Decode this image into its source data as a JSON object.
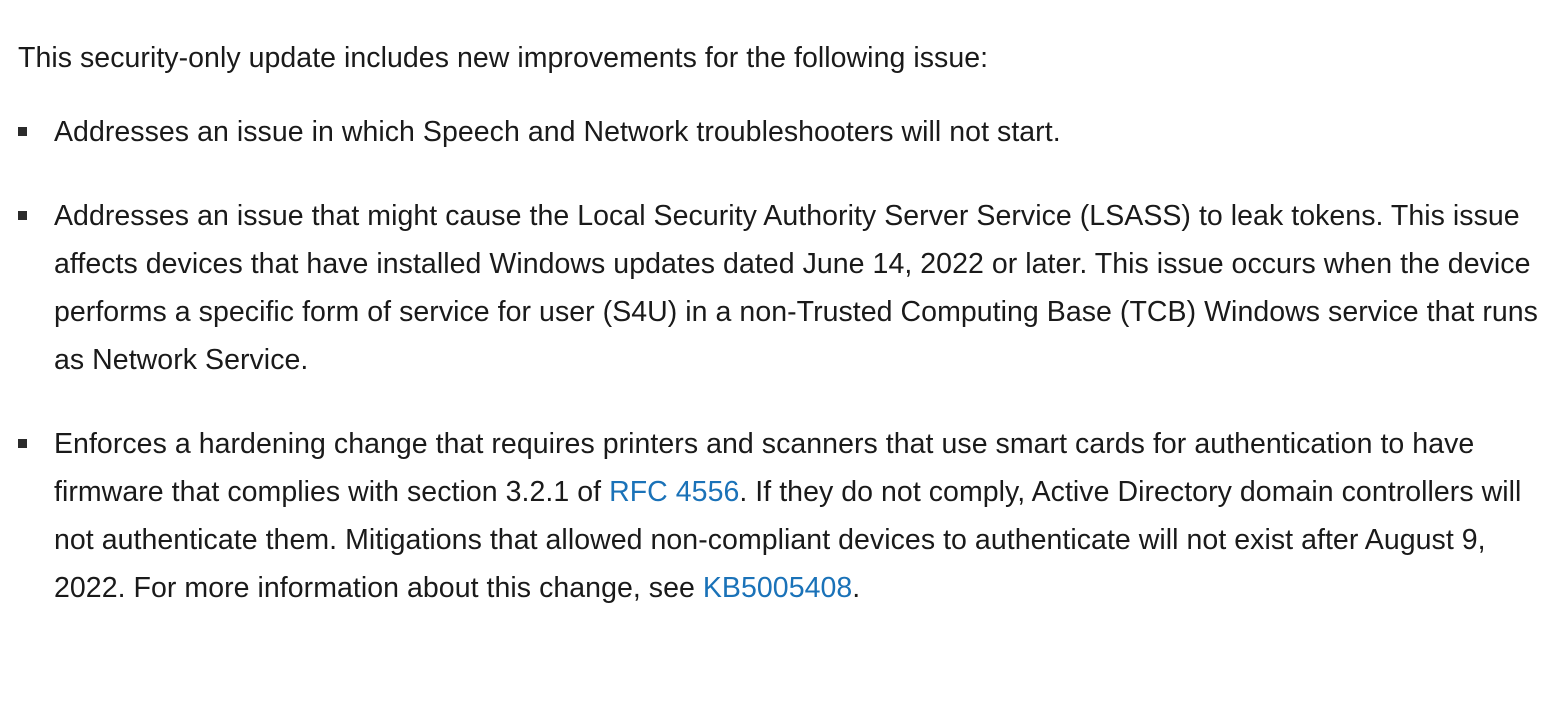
{
  "document": {
    "intro": "This security-only update includes new improvements for the following issue:",
    "bullet_marker_glyph": "filled-square",
    "bullet_marker_color": "#2b2b2b",
    "text_color": "#1a1a1a",
    "link_color": "#1a72b8",
    "background_color": "#ffffff",
    "bullets": [
      {
        "id": "troubleshooters",
        "text": "Addresses an issue in which Speech and Network troubleshooters will not start."
      },
      {
        "id": "lsass-token-leak",
        "text": "Addresses an issue that might cause the Local Security Authority Server Service (LSASS) to leak tokens. This issue affects devices that have installed Windows updates dated June 14, 2022 or later. This issue occurs when the device performs a specific form of service for user (S4U) in a non-Trusted Computing Base (TCB) Windows service that runs as Network Service."
      },
      {
        "id": "smart-card-hardening",
        "segments": {
          "part1": "Enforces a hardening change that requires printers and scanners that use smart cards for authentication to have firmware that complies with section 3.2.1 of ",
          "link1": "RFC 4556",
          "part2": ". If they do not comply, Active Directory domain controllers will not authenticate them. Mitigations that allowed non-compliant devices to authenticate will not exist after August 9, 2022. For more information about this change, see ",
          "link2": "KB5005408",
          "part3": "."
        }
      }
    ]
  }
}
